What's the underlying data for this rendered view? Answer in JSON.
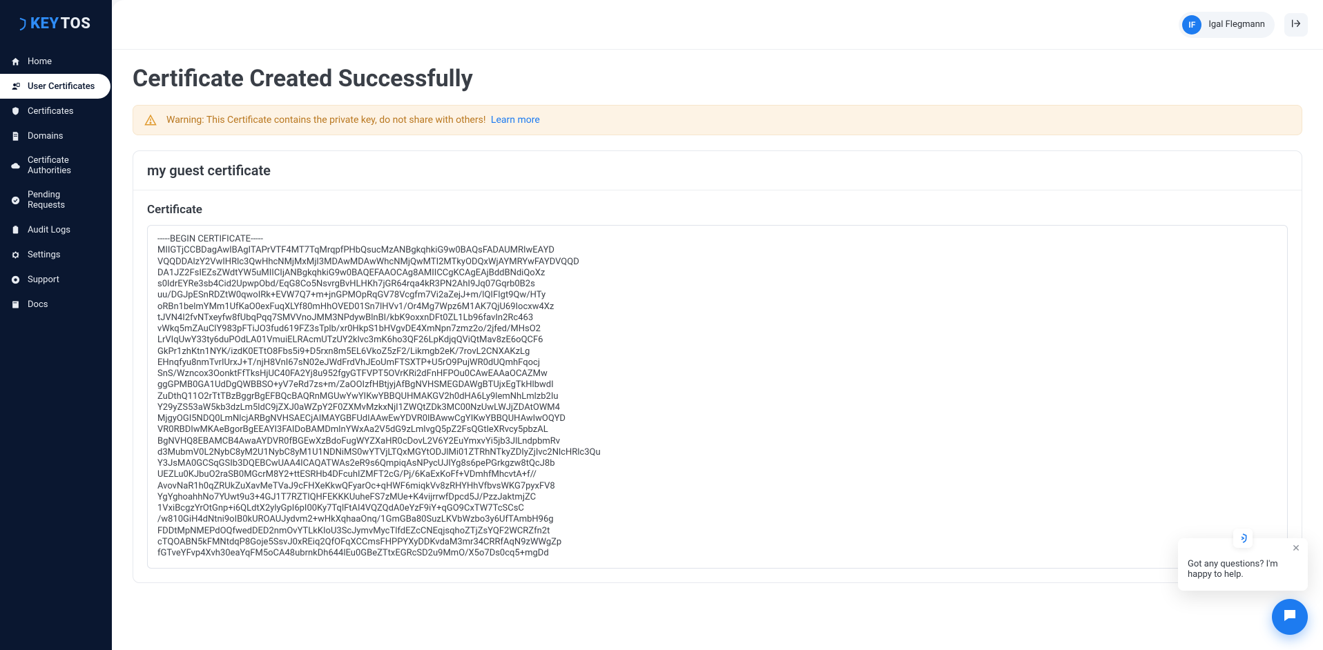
{
  "brand": {
    "part1": "KEY",
    "part2": "TOS"
  },
  "sidebar": {
    "items": [
      {
        "id": "home",
        "label": "Home"
      },
      {
        "id": "user-certs",
        "label": "User Certificates"
      },
      {
        "id": "certs",
        "label": "Certificates"
      },
      {
        "id": "domains",
        "label": "Domains"
      },
      {
        "id": "cas",
        "label": "Certificate Authorities"
      },
      {
        "id": "pending",
        "label": "Pending Requests"
      },
      {
        "id": "audit",
        "label": "Audit Logs"
      },
      {
        "id": "settings",
        "label": "Settings"
      },
      {
        "id": "support",
        "label": "Support"
      },
      {
        "id": "docs",
        "label": "Docs"
      }
    ],
    "active_id": "user-certs"
  },
  "topbar": {
    "user_initials": "IF",
    "user_name": "Igal Flegmann"
  },
  "page": {
    "title": "Certificate Created Successfully",
    "alert_text": "Warning: This Certificate contains the private key, do not share with others!",
    "alert_link_text": "Learn more"
  },
  "panel": {
    "name": "my guest certificate",
    "section_label": "Certificate",
    "certificate_text": "-----BEGIN CERTIFICATE-----\nMIIGTjCCBDagAwIBAgITAPrVTF4MT7TqMrqpfPHbQsucMzANBgkqhkiG9w0BAQsFADAUMRIwEAYD\nVQQDDAlzY2VwIHRlc3QwHhcNMjMxMjI3MDAwMDAwWhcNMjQwMTI2MTkyODQxWjAYMRYwFAYDVQQD\nDA1JZ2FsIEZsZWdtYW5uMIICIjANBgkqhkiG9w0BAQEFAAOCAg8AMIICCgKCAgEAjBddBNdiQoXz\ns0IdrEYRe3sb4Cid2UpwpObd/EqG8Co5NsvrgBvHLHKh7jGR64rqa4kR3PN2AhI9Jq07Gqrb0B2s\nuu/DGJpESnRDZtW0qwoIRk+EVW7Q7+m+jnGPMOpRqGV78Vcgfm7Vi2aZejJ+m/lQIFIgt9Qw/HTy\noRBn1belmYMm1UfKaO0exFuqXLYf80mHhOVED01Sn7lHVv1/Or4Mg7Wpz6M1AK7QjU69Iocxw4Xz\ntJVN4I2fvNTxeyfw8fUbqPqq7SMVVnoJMM3NPdywBlnBI/kbK9oxxnDFt0ZL1Lb96favIn2Rc463\nvWkq5mZAuClY983pFTiJO3fud619FZ3sTplb/xr0HkpS1bHVgvDE4XmNpn7zmz2o/2jfed/MHsO2\nLrVIqUwY33ty6duPOdLA01VmuiELRAcmUTzUY2klvc3mK6ho3QF26LpKdjqQViQtMav8zE6oQCF6\nGkPr1zhKtn1NYK/izdK0ETtO8Fbs5i9+D5rxn8m5EL6VkoZ5zF2/Likmgb2eK/7rovL2CNXAKzLg\nEHnqfyu8nmTvrIUrxJ+T/njH8VnI67sN02eJWdFrdVhJEoUmFTSXTP+U5rO9PujWR0dUQmhFqocj\nSnS/Wzncox3OonktFfTksHjUC40FA2Yj8u952fgyGTFVPT5OVrKRi2dFnHFPOu0CAwEAAaOCAZMw\nggGPMB0GA1UdDgQWBBSO+yV7eRd7zs+m/ZaOOIzfHBtjyjAfBgNVHSMEGDAWgBTUjxEgTkHlbwdI\nZuDthQ11O2rTtTBzBggrBgEFBQcBAQRnMGUwYwYIKwYBBQUHMAKGV2h0dHA6Ly9lemNhLmlzb2Iu\nY29yZS53aW5kb3dzLm5ldC9jZXJ0aWZpY2F0ZXMvMzkxNjI1ZWQtZDk3MC00NzUwLWJjZDAtOWM4\nMjgyOGI5NDQ0LmNlcjARBgNVHSAECjAIMAYGBFUdIAAwEwYDVR0lBAwwCgYIKwYBBQUHAwIwOQYD\nVR0RBDIwMKAeBgorBgEEAYI3FAIDoBAMDmlnYWxAa2V5dG9zLmlvgQ5pZ2FsQGtleXRvcy5pbzAL\nBgNVHQ8EBAMCB4AwaAYDVR0fBGEwXzBdoFugWYZXaHR0cDovL2V6Y2EuYmxvYi5jb3JlLndpbmRv\nd3MubmV0L2NybC8yM2U1NybC8yM1U1NDNiMS0wYTVjLTQxMGYtODJlMi01ZTRhNTkyZDIyZjIvc2NlcHRlc3Qu\nY3JsMA0GCSqGSIb3DQEBCwUAA4ICAQATWAs2eR9s6QmpiqAsNPycUJIYg8s6pePGrkgzw8tQcJ8b\nUEZLu0KJbuO2raSB0MGcrM8Y2+ttESRHb4DFcuhIZMFT2cG/Pj/6KaExKoFf+VDmhfMhcvtA+f//\nAvovNaR1h0qZRUkZuXavMeTVaJ9cFHXeKkwQFyarOc+qHWF6miqkVv8zRHYHhVfbvsWKG7pyxFV8\nYgYghoahhNo7YUwt9u3+4GJ1T7RZTlQHFEKKKUuheFS7zMUe+K4vijrrwfDpcd5J/PzzJaktmjZC\n1VxiBcgzYrOtGnp+i6QLdtX2ylyGpI6pI00Ky7TqlFtAI4VQZQdA0eYzF9iY+qGO9CxTW7TcSCsC\n/w810GiH4dNtni9oIB0kUROAUJydvm2+wHkXqhaaOnq/1GmGBa80SuzLKVbWzbo3y6UfTAmbH96g\nFDDtMpNMEPdOQfwedDED2nmOvYTLkKIoU3ScJymvMycTlfdEZcCNEqjsqhoZTjZsYQF2WCRZfn2t\ncTQOABN5kFMNtdqP8Goje5SsvJ0xREiq2QfOFqXCCmsFHPPYXyDDKvdaM3mr34CRRfAqN9zWWgZp\nfGTveYFvp4Xvh30eaYqFM5oCA48ubrnkDh644lEu0GBeZTtxEGRcSD2u9MmO/X5o7Ds0cq5+mgDd"
  },
  "chat": {
    "popover_text": "Got any questions? I'm happy to help."
  }
}
